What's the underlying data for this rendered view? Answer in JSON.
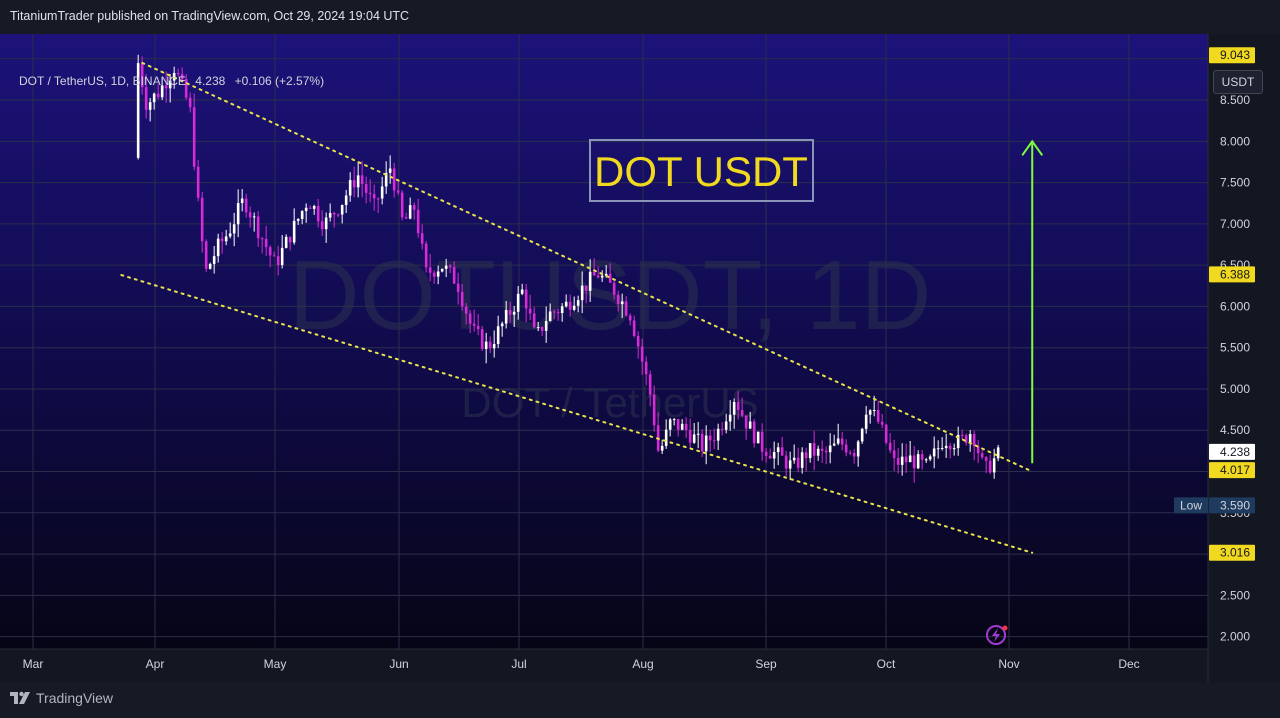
{
  "header": {
    "published_by": "TitaniumTrader published on TradingView.com, Oct 29, 2024 19:04 UTC"
  },
  "legend": {
    "pair": "DOT / TetherUS, 1D, BINANCE",
    "price": "4.238",
    "change": "+0.106 (+2.57%)"
  },
  "currency_button": "USDT",
  "footer": {
    "brand": "TradingView"
  },
  "colors": {
    "up": "#ffffff",
    "down": "#d62bd6",
    "trendline": "#e8e24b",
    "arrow": "#7cff3a",
    "label_yellow": "#f0d91e",
    "background_top": "#1c127a",
    "background_bottom": "#05040f"
  },
  "chart_data": {
    "type": "candlestick",
    "title": "DOT USDT",
    "watermark": [
      "DOTUSDT, 1D",
      "DOT / TetherUS"
    ],
    "x_labels": [
      "Mar",
      "Apr",
      "May",
      "Jun",
      "Jul",
      "Aug",
      "Sep",
      "Oct",
      "Nov",
      "Dec"
    ],
    "y_ticks": [
      "2.000",
      "2.500",
      "3.000",
      "3.500",
      "4.000",
      "4.500",
      "5.000",
      "5.500",
      "6.000",
      "6.500",
      "7.000",
      "7.500",
      "8.000",
      "8.500",
      "9.000"
    ],
    "ylim": [
      1.85,
      9.3
    ],
    "price_labels": [
      {
        "text": "9.043",
        "value": 9.043,
        "style": "yellow"
      },
      {
        "text": "6.388",
        "value": 6.388,
        "style": "yellow"
      },
      {
        "text": "4.238",
        "value": 4.238,
        "style": "white"
      },
      {
        "text": "4.017",
        "value": 4.017,
        "style": "yellow"
      },
      {
        "text": "3.590",
        "value": 3.59,
        "style": "blue",
        "tag": "Low"
      },
      {
        "text": "3.016",
        "value": 3.016,
        "style": "yellow"
      }
    ],
    "trendlines": [
      {
        "from": [
          "2024-03-27",
          8.95
        ],
        "to": [
          "2024-11-07",
          4.0
        ]
      },
      {
        "from": [
          "2024-03-22",
          6.38
        ],
        "to": [
          "2024-11-07",
          3.016
        ]
      }
    ],
    "target_arrow": {
      "date": "2024-11-07",
      "from": 4.1,
      "to": 8.0
    },
    "closes": [
      {
        "date": "2024-02-26",
        "close": 7.8
      },
      {
        "date": "2024-03-01",
        "close": 8.3
      },
      {
        "date": "2024-03-05",
        "close": 9.3
      },
      {
        "date": "2024-03-10",
        "close": 9.0
      },
      {
        "date": "2024-03-14",
        "close": 8.6
      },
      {
        "date": "2024-03-18",
        "close": 8.75
      },
      {
        "date": "2024-03-22",
        "close": 9.1
      },
      {
        "date": "2024-03-25",
        "close": 9.2
      },
      {
        "date": "2024-03-28",
        "close": 8.45
      },
      {
        "date": "2024-04-02",
        "close": 8.6
      },
      {
        "date": "2024-04-06",
        "close": 8.9
      },
      {
        "date": "2024-04-10",
        "close": 8.4
      },
      {
        "date": "2024-04-12",
        "close": 7.3
      },
      {
        "date": "2024-04-14",
        "close": 6.4
      },
      {
        "date": "2024-04-17",
        "close": 6.7
      },
      {
        "date": "2024-04-20",
        "close": 6.9
      },
      {
        "date": "2024-04-24",
        "close": 7.3
      },
      {
        "date": "2024-04-27",
        "close": 7.0
      },
      {
        "date": "2024-05-01",
        "close": 6.5
      },
      {
        "date": "2024-05-05",
        "close": 6.9
      },
      {
        "date": "2024-05-09",
        "close": 7.3
      },
      {
        "date": "2024-05-13",
        "close": 7.0
      },
      {
        "date": "2024-05-17",
        "close": 7.25
      },
      {
        "date": "2024-05-21",
        "close": 7.6
      },
      {
        "date": "2024-05-25",
        "close": 7.2
      },
      {
        "date": "2024-05-29",
        "close": 7.7
      },
      {
        "date": "2024-06-02",
        "close": 7.0
      },
      {
        "date": "2024-06-05",
        "close": 7.2
      },
      {
        "date": "2024-06-08",
        "close": 6.4
      },
      {
        "date": "2024-06-12",
        "close": 6.5
      },
      {
        "date": "2024-06-16",
        "close": 6.3
      },
      {
        "date": "2024-06-20",
        "close": 5.7
      },
      {
        "date": "2024-06-24",
        "close": 5.5
      },
      {
        "date": "2024-06-28",
        "close": 5.8
      },
      {
        "date": "2024-07-02",
        "close": 6.2
      },
      {
        "date": "2024-07-05",
        "close": 5.6
      },
      {
        "date": "2024-07-08",
        "close": 5.9
      },
      {
        "date": "2024-07-12",
        "close": 6.0
      },
      {
        "date": "2024-07-16",
        "close": 6.2
      },
      {
        "date": "2024-07-20",
        "close": 6.4
      },
      {
        "date": "2024-07-24",
        "close": 6.2
      },
      {
        "date": "2024-07-28",
        "close": 5.9
      },
      {
        "date": "2024-08-01",
        "close": 5.3
      },
      {
        "date": "2024-08-03",
        "close": 4.9
      },
      {
        "date": "2024-08-05",
        "close": 4.2
      },
      {
        "date": "2024-08-08",
        "close": 4.6
      },
      {
        "date": "2024-08-12",
        "close": 4.5
      },
      {
        "date": "2024-08-16",
        "close": 4.3
      },
      {
        "date": "2024-08-20",
        "close": 4.5
      },
      {
        "date": "2024-08-24",
        "close": 4.9
      },
      {
        "date": "2024-08-27",
        "close": 4.6
      },
      {
        "date": "2024-08-31",
        "close": 4.3
      },
      {
        "date": "2024-09-04",
        "close": 4.2
      },
      {
        "date": "2024-09-08",
        "close": 4.05
      },
      {
        "date": "2024-09-12",
        "close": 4.25
      },
      {
        "date": "2024-09-16",
        "close": 4.2
      },
      {
        "date": "2024-09-20",
        "close": 4.35
      },
      {
        "date": "2024-09-24",
        "close": 4.25
      },
      {
        "date": "2024-09-27",
        "close": 4.8
      },
      {
        "date": "2024-09-30",
        "close": 4.6
      },
      {
        "date": "2024-10-03",
        "close": 4.1
      },
      {
        "date": "2024-10-07",
        "close": 4.15
      },
      {
        "date": "2024-10-11",
        "close": 4.05
      },
      {
        "date": "2024-10-15",
        "close": 4.4
      },
      {
        "date": "2024-10-19",
        "close": 4.35
      },
      {
        "date": "2024-10-22",
        "close": 4.5
      },
      {
        "date": "2024-10-25",
        "close": 4.0
      },
      {
        "date": "2024-10-29",
        "close": 4.238
      }
    ]
  }
}
